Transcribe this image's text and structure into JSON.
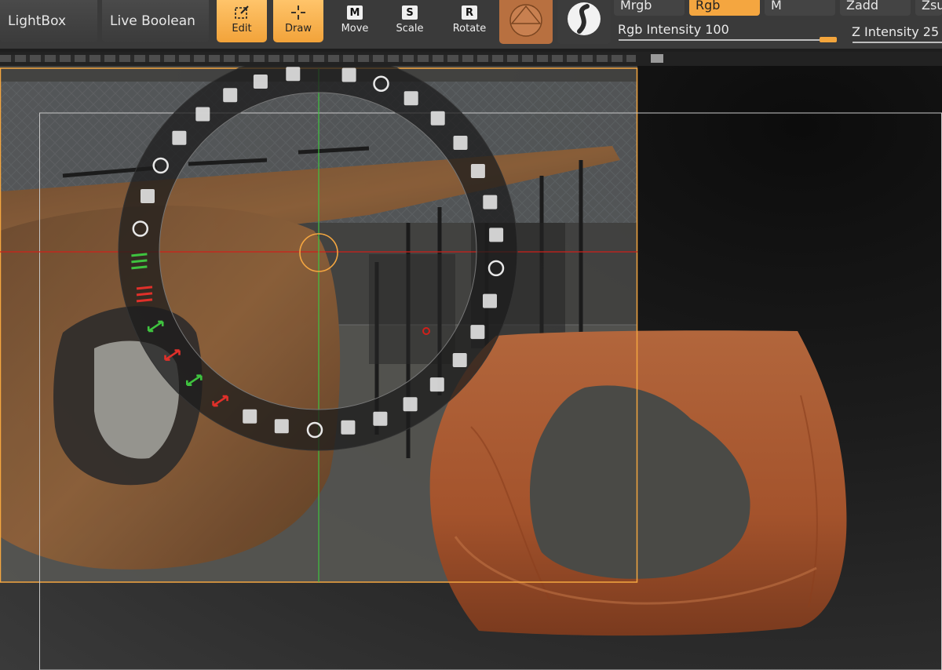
{
  "toolbar": {
    "lightbox_label": "LightBox",
    "live_boolean_label": "Live Boolean",
    "edit_label": "Edit",
    "draw_label": "Draw",
    "move_label": "Move",
    "move_key": "M",
    "scale_label": "Scale",
    "scale_key": "S",
    "rotate_label": "Rotate",
    "rotate_key": "R"
  },
  "modes": {
    "mrgb_label": "Mrgb",
    "rgb_label": "Rgb",
    "m_label": "M",
    "zadd_label": "Zadd",
    "zsub_label": "Zsu"
  },
  "sliders": {
    "rgb_intensity_label": "Rgb Intensity",
    "rgb_intensity_value": "100",
    "z_intensity_label": "Z Intensity",
    "z_intensity_value": "25"
  },
  "colors": {
    "accent": "#f4a640",
    "panel": "#3a3a3a",
    "crosshair_red": "#d0201a",
    "crosshair_green": "#3fc33f",
    "wood": "#a4532c"
  },
  "radial_menu": {
    "icons": [
      "pencil-icon",
      "rainbow-brush-icon",
      "brush-icon",
      "brush-small-icon",
      "curve-brush-icon",
      "sphere-icon",
      "grid-icon",
      "refresh-cycle-icon",
      "lines-green-icon",
      "lines-red-icon",
      "double-arrow-green-icon",
      "double-arrow-red-icon",
      "up-arrows-green-icon",
      "swap-arrows-red-icon",
      "crop-icon",
      "camera-icon",
      "overlap-circles-icon",
      "copy-pages-icon",
      "scissors-icon",
      "stack-squares-icon",
      "stack-squares-alt-icon",
      "tiles-icon",
      "tiles-alt-icon",
      "tiles-corner-icon",
      "refresh-icon",
      "square-layers-icon",
      "square-layers-alt-icon",
      "cube-icon",
      "cone-icon",
      "stamp-icon",
      "frame-icon",
      "rotate-circle-icon",
      "palette-icon"
    ]
  }
}
